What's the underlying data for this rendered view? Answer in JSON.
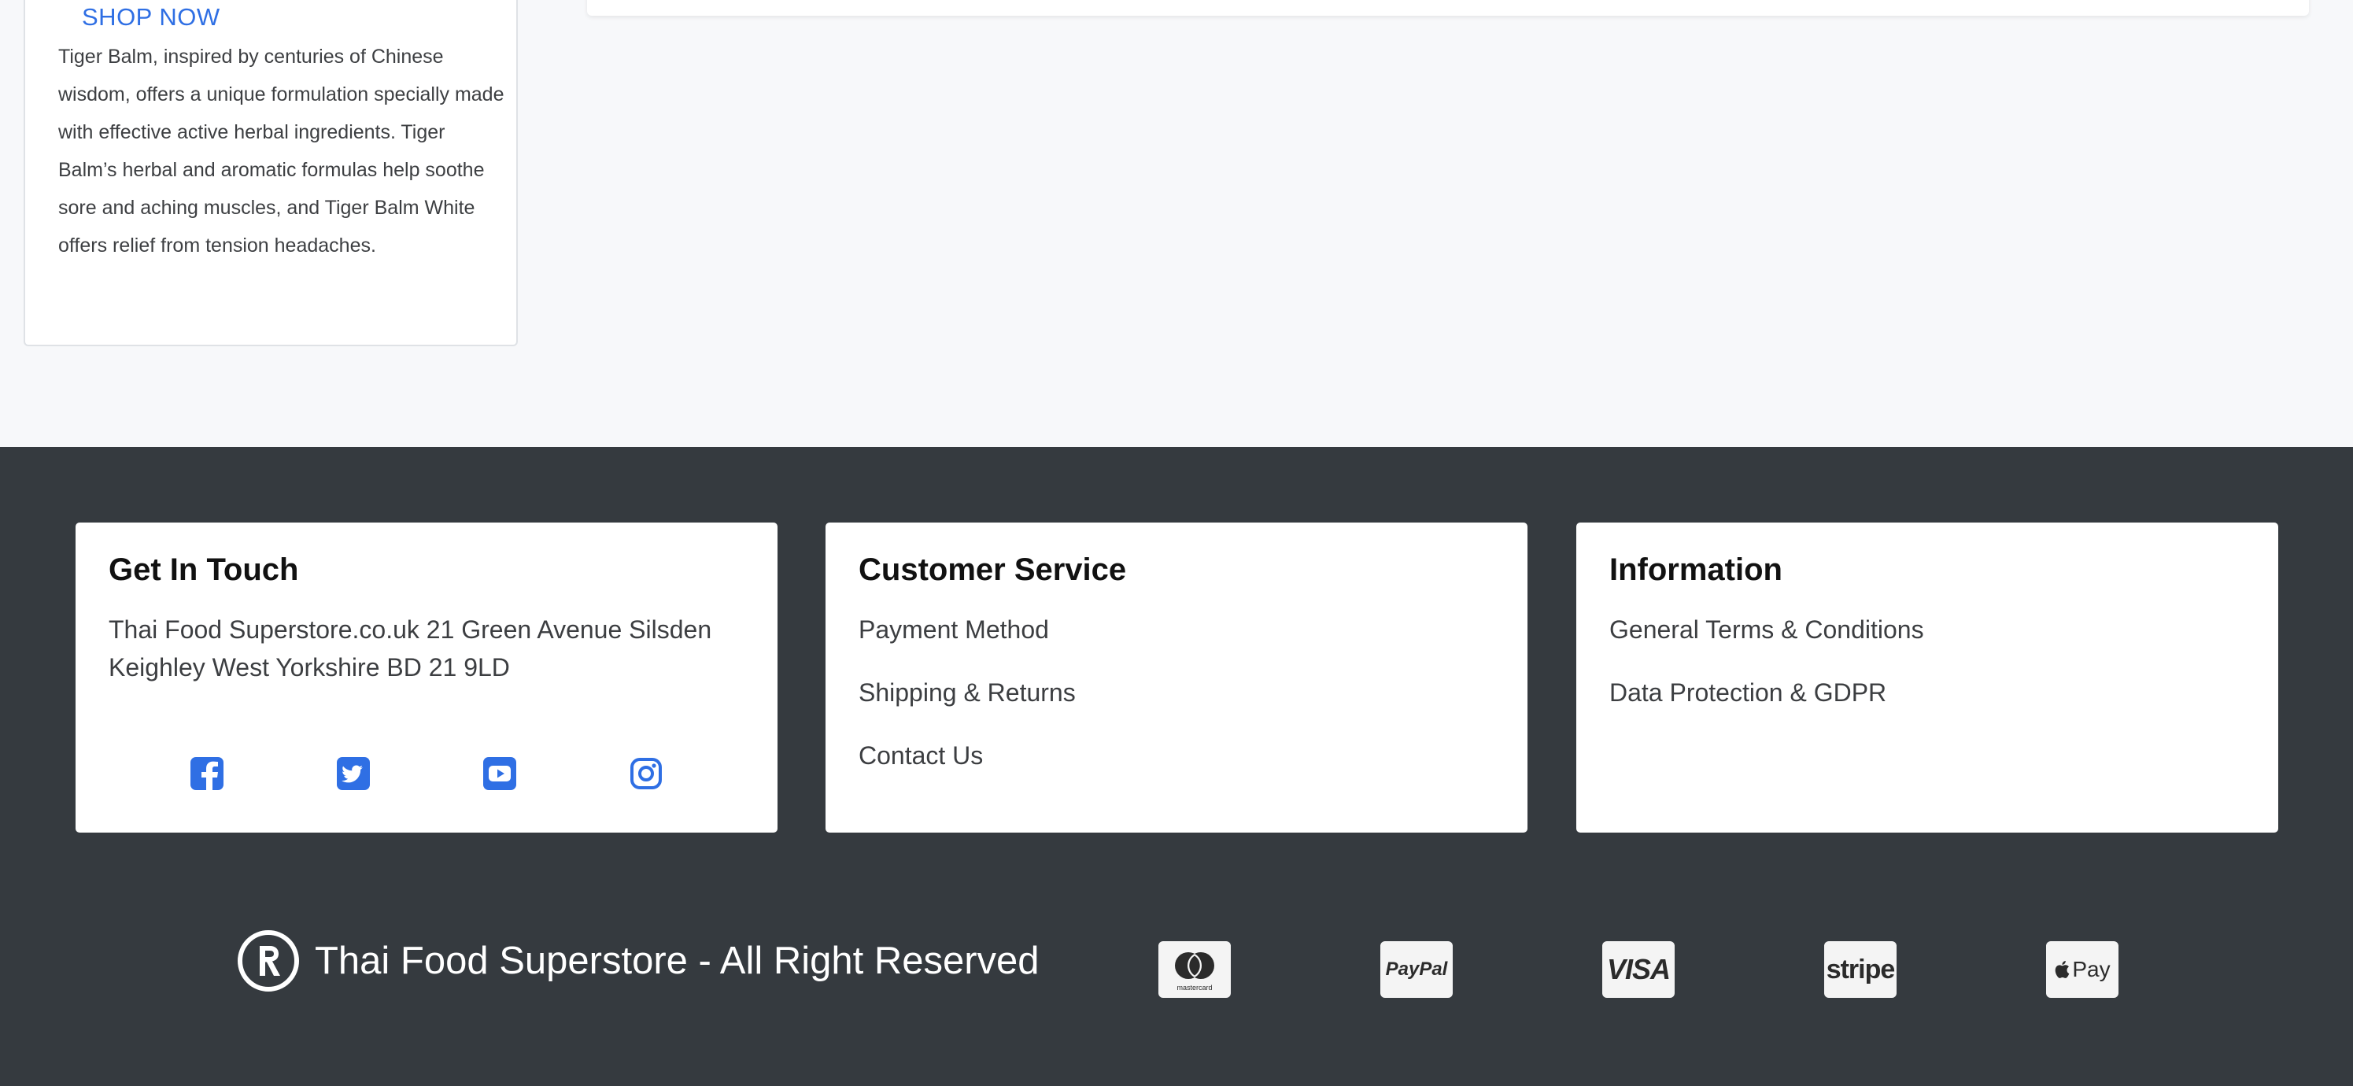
{
  "product": {
    "shop_now": "SHOP NOW",
    "description": "Tiger Balm, inspired by centuries of Chinese wisdom, offers a unique formulation specially made with effective active herbal ingredients. Tiger Balm’s herbal and aromatic formulas help soothe sore and aching muscles, and Tiger Balm White offers relief from tension headaches."
  },
  "footer": {
    "get_in_touch": {
      "title": "Get In Touch",
      "address": "Thai Food Superstore.co.uk 21 Green Avenue Silsden Keighley West Yorkshire BD 21 9LD",
      "social_icons": [
        "facebook-icon",
        "twitter-icon",
        "youtube-icon",
        "instagram-icon"
      ]
    },
    "customer_service": {
      "title": "Customer Service",
      "links": [
        "Payment Method",
        "Shipping & Returns",
        "Contact Us"
      ]
    },
    "information": {
      "title": "Information",
      "links": [
        "General Terms & Conditions",
        "Data Protection & GDPR"
      ]
    },
    "copyright": "Thai Food Superstore - All Right Reserved",
    "payments": {
      "mastercard_label": "mastercard",
      "paypal_label": "PayPal",
      "visa_label": "VISA",
      "stripe_label": "stripe",
      "applepay_label": "Pay"
    }
  },
  "colors": {
    "link_blue": "#2f6fe4",
    "footer_bg": "#353a3f",
    "page_bg": "#f7f8fa"
  }
}
